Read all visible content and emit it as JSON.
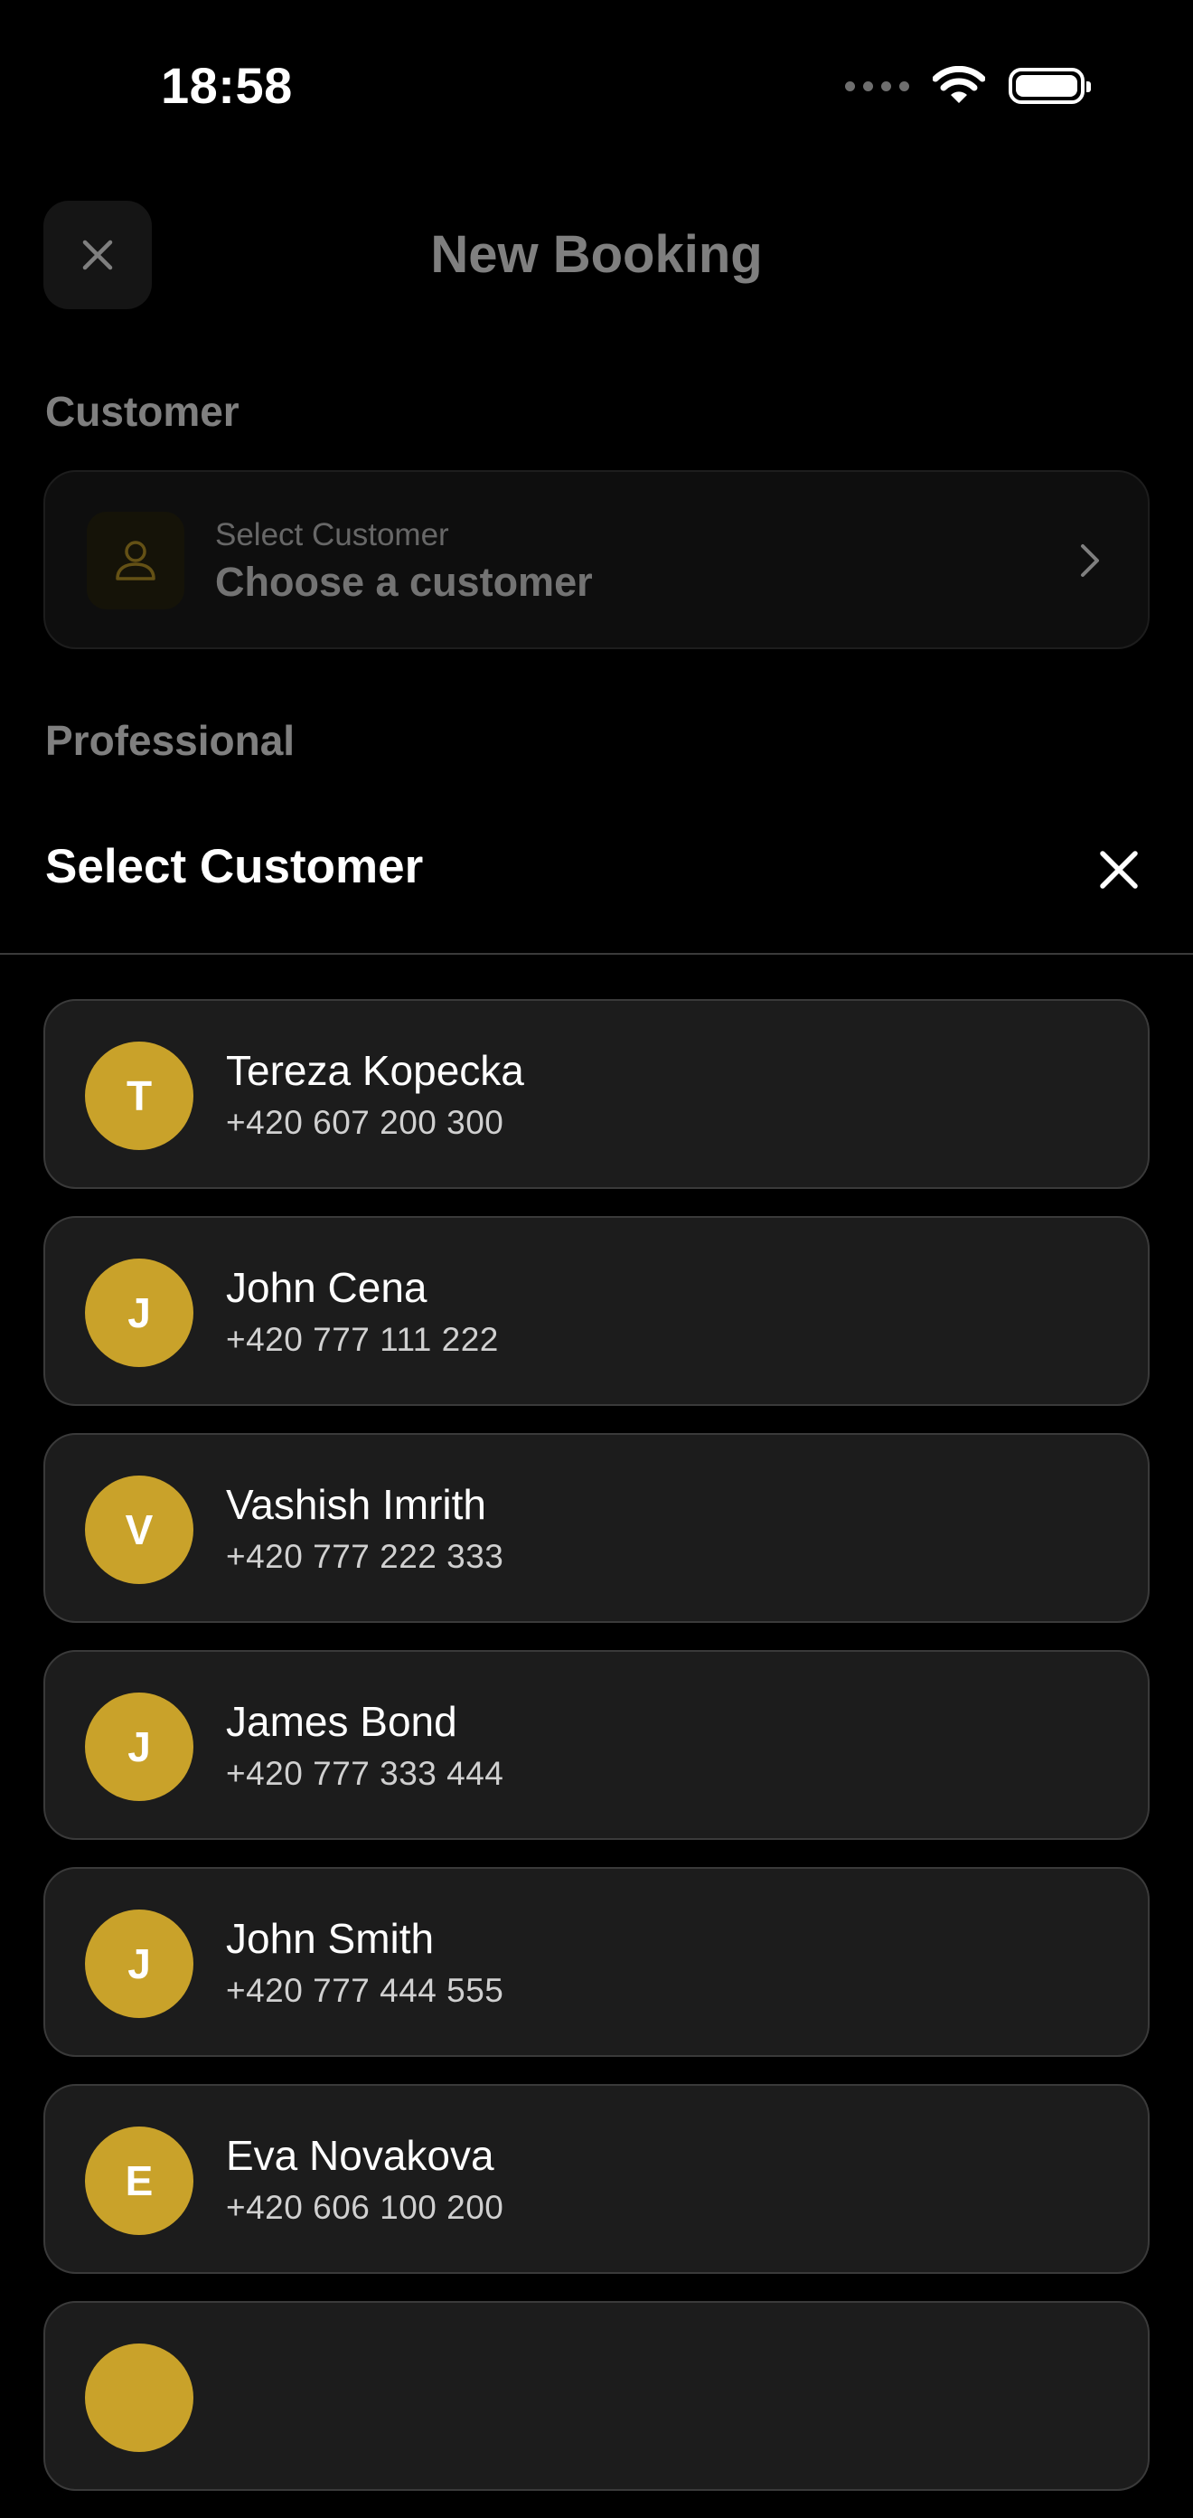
{
  "status_bar": {
    "time": "18:58"
  },
  "header": {
    "title": "New Booking"
  },
  "form": {
    "customer_section_label": "Customer",
    "customer_selector": {
      "label": "Select Customer",
      "value": "Choose a customer"
    },
    "professional_section_label": "Professional"
  },
  "sheet": {
    "title": "Select Customer",
    "customers": [
      {
        "initial": "T",
        "name": "Tereza Kopecka",
        "phone": "+420 607 200 300"
      },
      {
        "initial": "J",
        "name": "John Cena",
        "phone": "+420 777 111 222"
      },
      {
        "initial": "V",
        "name": "Vashish Imrith",
        "phone": "+420 777 222 333"
      },
      {
        "initial": "J",
        "name": "James Bond",
        "phone": "+420 777 333 444"
      },
      {
        "initial": "J",
        "name": "John Smith",
        "phone": "+420 777 444 555"
      },
      {
        "initial": "E",
        "name": "Eva Novakova",
        "phone": "+420 606 100 200"
      },
      {
        "initial": "",
        "name": "",
        "phone": ""
      }
    ]
  },
  "colors": {
    "accent_gold": "#c9a22a",
    "background": "#000000",
    "card": "#1c1c1c"
  }
}
